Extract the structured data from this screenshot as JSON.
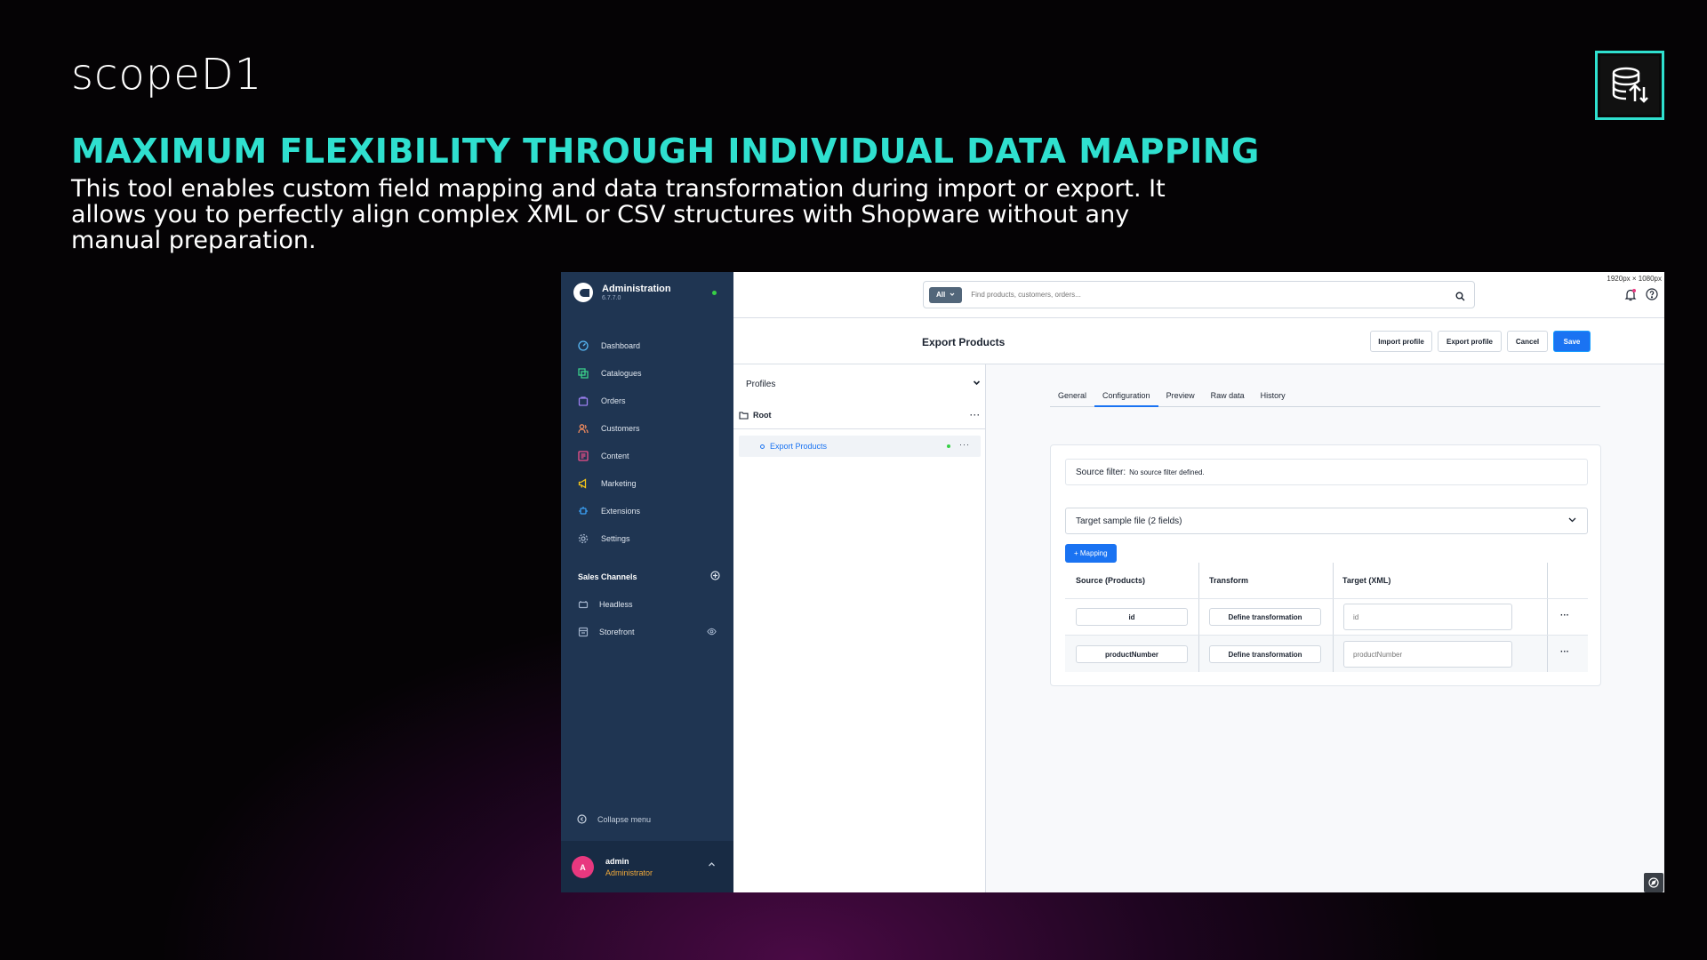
{
  "brand": {
    "logo_text": "scopeD1"
  },
  "headline": "MAXIMUM FLEXIBILITY THROUGH INDIVIDUAL DATA MAPPING",
  "intro": "This tool enables custom field mapping and data transformation during import or export. It allows you to perfectly align complex XML or CSV structures with Shopware without any manual preparation.",
  "colors": {
    "accent": "#2fe0cf",
    "sidebar": "#1f3552",
    "primary_button": "#1a73f2",
    "online": "#37d046"
  },
  "admin": {
    "title": "Administration",
    "version": "6.7.7.0",
    "resolution_note": "1920px × 1080px",
    "sidebar": {
      "items": [
        {
          "label": "Dashboard",
          "icon": "dashboard-icon"
        },
        {
          "label": "Catalogues",
          "icon": "catalogue-icon"
        },
        {
          "label": "Orders",
          "icon": "orders-icon"
        },
        {
          "label": "Customers",
          "icon": "customers-icon"
        },
        {
          "label": "Content",
          "icon": "content-icon"
        },
        {
          "label": "Marketing",
          "icon": "marketing-icon"
        },
        {
          "label": "Extensions",
          "icon": "extensions-icon"
        },
        {
          "label": "Settings",
          "icon": "settings-icon"
        }
      ],
      "sales_channels_label": "Sales Channels",
      "sales_channels": [
        {
          "label": "Headless"
        },
        {
          "label": "Storefront"
        }
      ],
      "collapse_label": "Collapse menu",
      "user": {
        "initial": "A",
        "name": "admin",
        "role": "Administrator"
      }
    },
    "search": {
      "scope": "All",
      "placeholder": "Find products, customers, orders..."
    },
    "page": {
      "title": "Export Products",
      "buttons": {
        "import": "Import profile",
        "export": "Export profile",
        "cancel": "Cancel",
        "save": "Save"
      }
    },
    "profiles": {
      "label": "Profiles",
      "root": "Root",
      "child": "Export Products"
    },
    "tabs": [
      "General",
      "Configuration",
      "Preview",
      "Raw data",
      "History"
    ],
    "active_tab": "Configuration",
    "config": {
      "source_filter_label": "Source filter:",
      "source_filter_value": "No source filter defined.",
      "target_sample": "Target sample file (2 fields)",
      "add_mapping": "+ Mapping",
      "columns": [
        "Source (Products)",
        "Transform",
        "Target (XML)"
      ],
      "rows": [
        {
          "source": "id",
          "transform": "Define transformation",
          "target": "id"
        },
        {
          "source": "productNumber",
          "transform": "Define transformation",
          "target": "productNumber"
        }
      ]
    }
  }
}
